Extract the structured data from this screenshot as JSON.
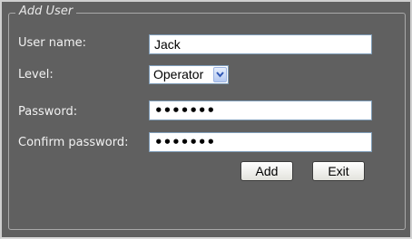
{
  "form": {
    "legend": "Add User",
    "username_label": "User name:",
    "username_value": "Jack",
    "level_label": "Level:",
    "level_value": "Operator",
    "password_label": "Password:",
    "password_value": "•••••••",
    "confirm_label": "Confirm password:",
    "confirm_value": "•••••••",
    "add_label": "Add",
    "exit_label": "Exit"
  },
  "icons": {
    "level_dropdown": "chevron-down-icon"
  },
  "colors": {
    "background": "#606060",
    "input_border": "#7f9db9",
    "dropdown_accent": "#b4c8f0"
  }
}
